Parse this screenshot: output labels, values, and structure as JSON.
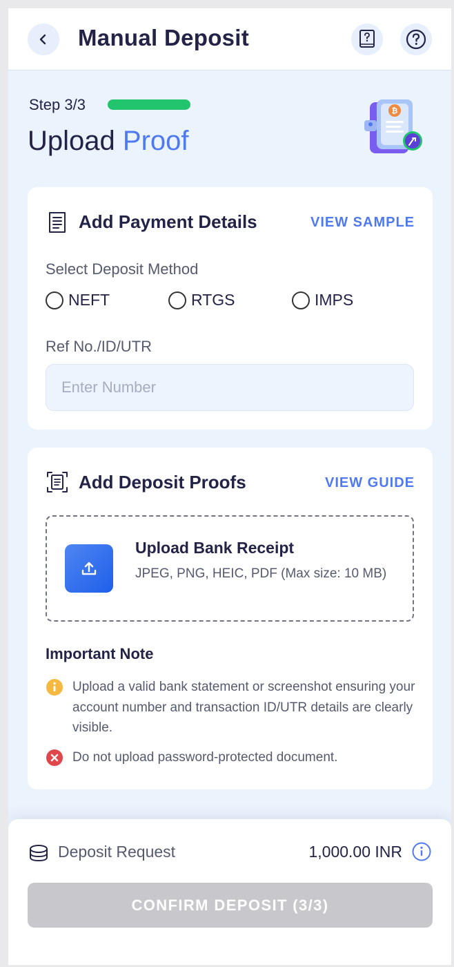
{
  "header": {
    "title": "Manual Deposit",
    "back_icon": "chevron-left-icon",
    "guide_icon": "book-question-icon",
    "help_icon": "question-circle-icon"
  },
  "step": {
    "label": "Step 3/3",
    "progress": 1.0,
    "progress_color": "#22c46e"
  },
  "page_heading": {
    "text": "Upload",
    "accent": "Proof",
    "accent_color": "#4f79f1"
  },
  "payment_details": {
    "title": "Add Payment Details",
    "link": "VIEW SAMPLE",
    "method_label": "Select Deposit Method",
    "methods": [
      "NEFT",
      "RTGS",
      "IMPS"
    ],
    "ref_label": "Ref No./ID/UTR",
    "ref_value": "",
    "ref_placeholder": "Enter Number"
  },
  "deposit_proofs": {
    "title": "Add Deposit Proofs",
    "link": "VIEW GUIDE",
    "upload_title": "Upload Bank Receipt",
    "upload_subtitle": "JPEG, PNG, HEIC, PDF (Max size: 10 MB)",
    "note_title": "Important Note",
    "notes": [
      {
        "type": "warning",
        "icon": "info-warning-icon",
        "color": "#f5b942",
        "text": "Upload a valid bank statement or screenshot ensuring your account number and transaction ID/UTR details are clearly visible."
      },
      {
        "type": "error",
        "icon": "error-x-icon",
        "color": "#e0474c",
        "text": "Do not upload password-protected document."
      }
    ]
  },
  "footer": {
    "label": "Deposit Request",
    "amount": "1,000.00 INR",
    "button": "CONFIRM DEPOSIT (3/3)"
  },
  "colors": {
    "accent": "#4f79f1",
    "background": "#ebf3fd",
    "text": "#232347",
    "disabled_button": "#c8c8cc"
  }
}
